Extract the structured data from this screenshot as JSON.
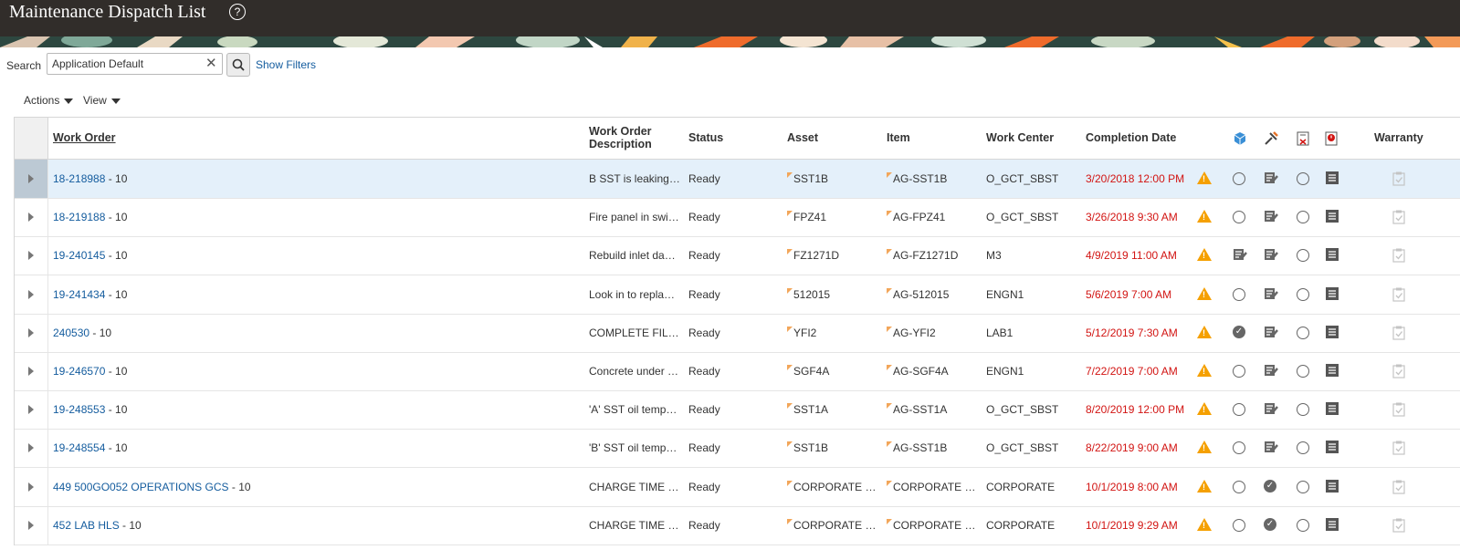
{
  "header": {
    "title": "Maintenance Dispatch List",
    "help": "?"
  },
  "search": {
    "label": "Search",
    "value": "Application Default",
    "show_filters": "Show Filters"
  },
  "toolbar": {
    "actions": "Actions",
    "view": "View"
  },
  "columns": {
    "work_order": "Work Order",
    "description": "Work Order Description",
    "status": "Status",
    "asset": "Asset",
    "item": "Item",
    "work_center": "Work Center",
    "completion_date": "Completion Date",
    "warranty": "Warranty"
  },
  "rows": [
    {
      "wo": "18-218988",
      "op": " - 10",
      "desc": "B SST is leaking…",
      "status": "Ready",
      "asset": "SST1B",
      "item": "AG-SST1B",
      "wc": "O_GCT_SBST",
      "date": "3/20/2018 12:00 PM",
      "col2": "circle"
    },
    {
      "wo": "18-219188",
      "op": " - 10",
      "desc": "Fire panel in swi…",
      "status": "Ready",
      "asset": "FPZ41",
      "item": "AG-FPZ41",
      "wc": "O_GCT_SBST",
      "date": "3/26/2018 9:30 AM",
      "col2": "circle"
    },
    {
      "wo": "19-240145",
      "op": " - 10",
      "desc": "Rebuild inlet da…",
      "status": "Ready",
      "asset": "FZ1271D",
      "item": "AG-FZ1271D",
      "wc": "M3",
      "date": "4/9/2019 11:00 AM",
      "col2": "edit"
    },
    {
      "wo": "19-241434",
      "op": " - 10",
      "desc": "Look in to repla…",
      "status": "Ready",
      "asset": "512015",
      "item": "AG-512015",
      "wc": "ENGN1",
      "date": "5/6/2019 7:00 AM",
      "col2": "circle"
    },
    {
      "wo": "240530",
      "op": " - 10",
      "desc": "COMPLETE FIL…",
      "status": "Ready",
      "asset": "YFI2",
      "item": "AG-YFI2",
      "wc": "LAB1",
      "date": "5/12/2019 7:30 AM",
      "col2": "done"
    },
    {
      "wo": "19-246570",
      "op": " - 10",
      "desc": "Concrete under …",
      "status": "Ready",
      "asset": "SGF4A",
      "item": "AG-SGF4A",
      "wc": "ENGN1",
      "date": "7/22/2019 7:00 AM",
      "col2": "circle"
    },
    {
      "wo": "19-248553",
      "op": " - 10",
      "desc": "'A' SST oil temp…",
      "status": "Ready",
      "asset": "SST1A",
      "item": "AG-SST1A",
      "wc": "O_GCT_SBST",
      "date": "8/20/2019 12:00 PM",
      "col2": "circle"
    },
    {
      "wo": "19-248554",
      "op": " - 10",
      "desc": "'B' SST oil temp…",
      "status": "Ready",
      "asset": "SST1B",
      "item": "AG-SST1B",
      "wc": "O_GCT_SBST",
      "date": "8/22/2019 9:00 AM",
      "col2": "circle"
    },
    {
      "wo": "449 500GO052 OPERATIONS GCS",
      "op": " - 10",
      "desc": "CHARGE TIME …",
      "status": "Ready",
      "asset": "CORPORATE …",
      "item": "CORPORATE …",
      "wc": "CORPORATE",
      "date": "10/1/2019 8:00 AM",
      "col2": "circle",
      "col3": "done"
    },
    {
      "wo": "452 LAB HLS",
      "op": " - 10",
      "desc": "CHARGE TIME …",
      "status": "Ready",
      "asset": "CORPORATE …",
      "item": "CORPORATE …",
      "wc": "CORPORATE",
      "date": "10/1/2019 9:29 AM",
      "col2": "circle",
      "col3": "done"
    }
  ],
  "colors": {
    "link": "#145c9e",
    "overdue": "#d21412",
    "warning": "#f5a000",
    "header_bg": "#312d2a"
  },
  "icons": {
    "warning": "warning-icon",
    "checklist": "checklist-icon",
    "list": "list-icon",
    "warranty": "clipboard-check-icon"
  }
}
